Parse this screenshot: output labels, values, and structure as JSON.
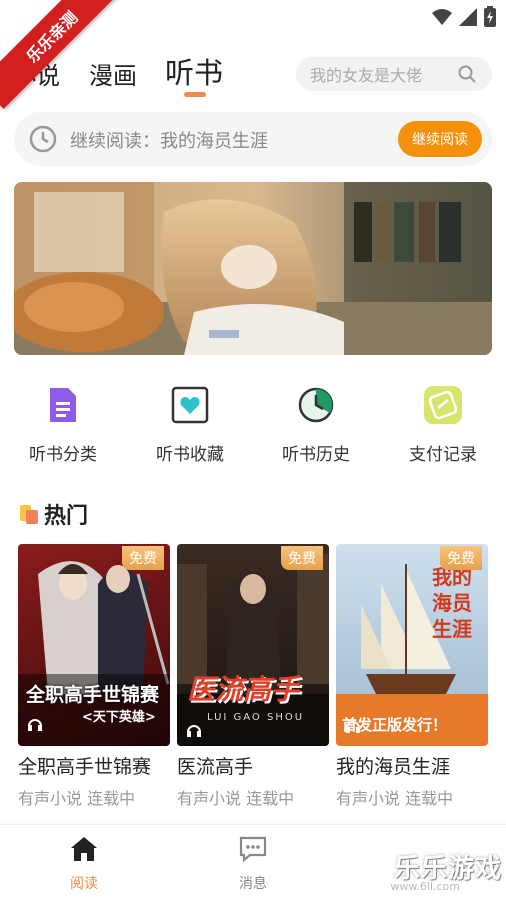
{
  "watermark_ribbon": "乐乐亲测",
  "tabs": [
    {
      "label": "小说",
      "active": false
    },
    {
      "label": "漫画",
      "active": false
    },
    {
      "label": "听书",
      "active": true
    }
  ],
  "search": {
    "placeholder": "我的女友是大佬",
    "icon": "search-icon"
  },
  "continue_reading": {
    "label": "继续阅读：我的海员生涯",
    "button": "继续阅读",
    "icon": "clock-icon"
  },
  "categories": [
    {
      "label": "听书分类",
      "icon": "document-icon",
      "color": "#8e5ce8"
    },
    {
      "label": "听书收藏",
      "icon": "heart-icon",
      "color": "#2bc3c8"
    },
    {
      "label": "听书历史",
      "icon": "history-clock-icon",
      "color": "#1f9a62"
    },
    {
      "label": "支付记录",
      "icon": "coupon-icon",
      "color": "#cddf5a"
    }
  ],
  "hot_section": {
    "title": "热门"
  },
  "books": [
    {
      "title": "全职高手世锦赛",
      "subtitle": "有声小说 连载中",
      "badge": "免费",
      "cover_text": "全职高手世锦赛",
      "cover_sub": "<天下英雄>"
    },
    {
      "title": "医流高手",
      "subtitle": "有声小说 连载中",
      "badge": "免费",
      "cover_text": "医流高手",
      "cover_sub": "LUI GAO SHOU"
    },
    {
      "title": "我的海员生涯",
      "subtitle": "有声小说 连载中",
      "badge": "免费",
      "cover_text": "我的海员生涯",
      "cover_sub": "首发正版发行！"
    }
  ],
  "bottom_nav": [
    {
      "label": "阅读",
      "icon": "home-icon",
      "active": true
    },
    {
      "label": "消息",
      "icon": "message-icon",
      "active": false
    }
  ],
  "watermark_site": {
    "brand": "乐乐游戏",
    "url": "www.6ll.com"
  },
  "colors": {
    "accent": "#f5900a",
    "tab_indicator": "#f08a4b",
    "nav_active": "#f08a4b"
  }
}
